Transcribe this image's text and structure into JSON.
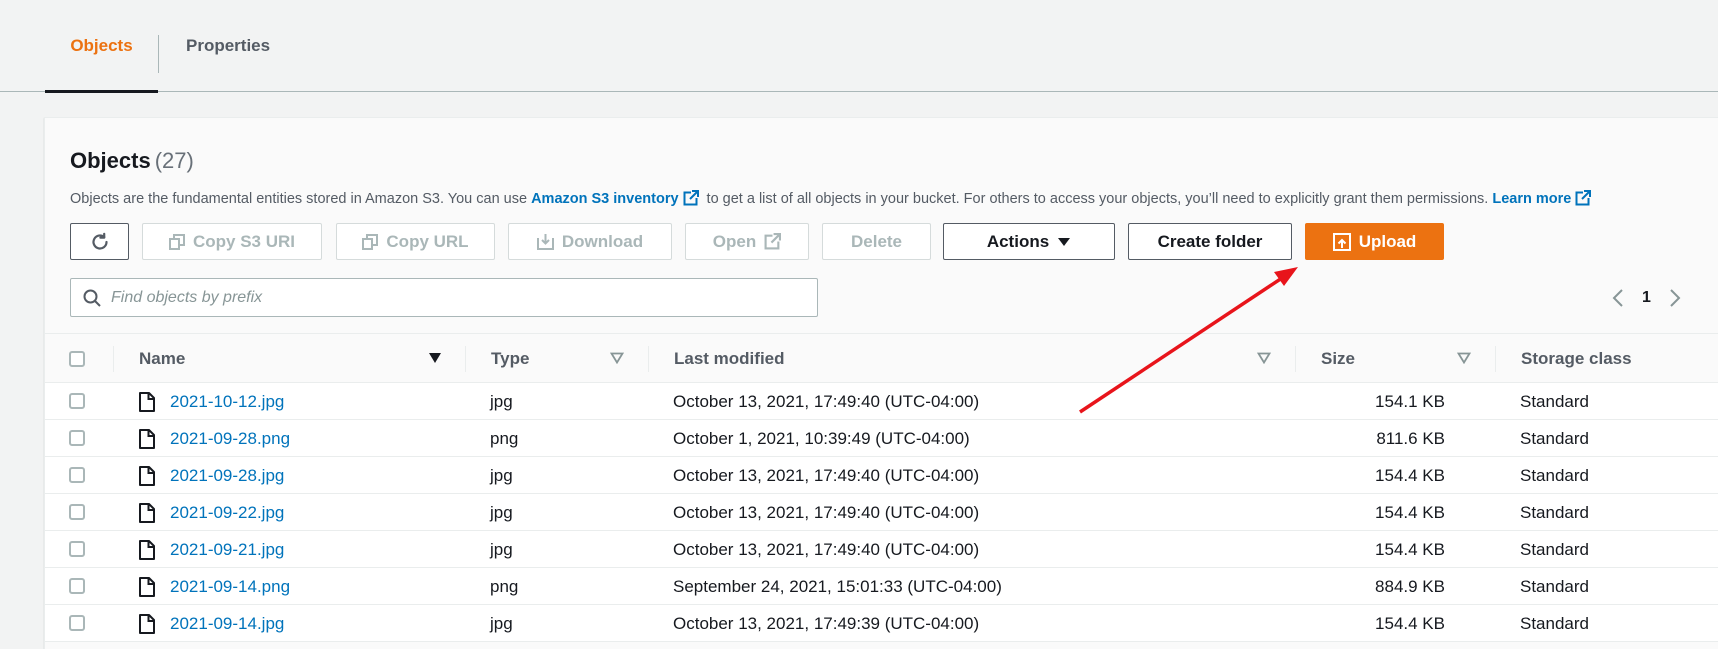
{
  "tabs": [
    {
      "label": "Objects",
      "active": true
    },
    {
      "label": "Properties",
      "active": false
    }
  ],
  "header": {
    "title": "Objects",
    "count": "(27)",
    "description_prefix": "Objects are the fundamental entities stored in Amazon S3. You can use ",
    "inventory_link": "Amazon S3 inventory",
    "description_middle": " to get a list of all objects in your bucket. For others to access your objects, you’ll need to explicitly grant them permissions. ",
    "learn_more_link": "Learn more"
  },
  "toolbar": {
    "refresh_icon": "refresh-icon",
    "copy_s3_uri": "Copy S3 URI",
    "copy_url": "Copy URL",
    "download": "Download",
    "open": "Open",
    "delete": "Delete",
    "actions": "Actions",
    "create_folder": "Create folder",
    "upload": "Upload"
  },
  "search": {
    "placeholder": "Find objects by prefix",
    "value": ""
  },
  "pagination": {
    "current_page": "1"
  },
  "table": {
    "columns": [
      "Name",
      "Type",
      "Last modified",
      "Size",
      "Storage class"
    ],
    "rows": [
      {
        "name": "2021-10-12.jpg",
        "type": "jpg",
        "last_modified": "October 13, 2021, 17:49:40 (UTC-04:00)",
        "size": "154.1 KB",
        "storage_class": "Standard"
      },
      {
        "name": "2021-09-28.png",
        "type": "png",
        "last_modified": "October 1, 2021, 10:39:49 (UTC-04:00)",
        "size": "811.6 KB",
        "storage_class": "Standard"
      },
      {
        "name": "2021-09-28.jpg",
        "type": "jpg",
        "last_modified": "October 13, 2021, 17:49:40 (UTC-04:00)",
        "size": "154.4 KB",
        "storage_class": "Standard"
      },
      {
        "name": "2021-09-22.jpg",
        "type": "jpg",
        "last_modified": "October 13, 2021, 17:49:40 (UTC-04:00)",
        "size": "154.4 KB",
        "storage_class": "Standard"
      },
      {
        "name": "2021-09-21.jpg",
        "type": "jpg",
        "last_modified": "October 13, 2021, 17:49:40 (UTC-04:00)",
        "size": "154.4 KB",
        "storage_class": "Standard"
      },
      {
        "name": "2021-09-14.png",
        "type": "png",
        "last_modified": "September 24, 2021, 15:01:33 (UTC-04:00)",
        "size": "884.9 KB",
        "storage_class": "Standard"
      },
      {
        "name": "2021-09-14.jpg",
        "type": "jpg",
        "last_modified": "October 13, 2021, 17:49:39 (UTC-04:00)",
        "size": "154.4 KB",
        "storage_class": "Standard"
      }
    ]
  },
  "colors": {
    "accent": "#ec7211",
    "link": "#0073bb",
    "annotation_arrow": "#e8141b"
  }
}
